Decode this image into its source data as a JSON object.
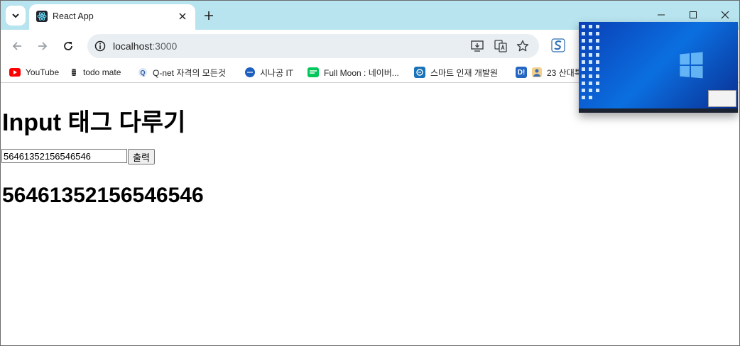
{
  "browser": {
    "tab": {
      "title": "React App"
    },
    "address": {
      "host": "localhost",
      "port": ":3000"
    },
    "bookmarks": [
      {
        "label": "YouTube",
        "icon": "youtube-icon",
        "color": "#ff0000"
      },
      {
        "label": "todo mate",
        "icon": "todo-mate-icon",
        "color": "#222222"
      },
      {
        "label": "Q-net 자격의 모든것",
        "icon": "qnet-icon",
        "color": "#2a5aa8"
      },
      {
        "label": "시나공 IT",
        "icon": "sinagong-icon",
        "color": "#1f5fbf"
      },
      {
        "label": "Full Moon : 네이버...",
        "icon": "naver-blog-icon",
        "color": "#03c75a"
      },
      {
        "label": "스마트 인재 개발원",
        "icon": "smart-icon",
        "color": "#1a73b8"
      },
      {
        "label": "23 산대특",
        "icon": "profile-icon",
        "color": "#2566c2"
      }
    ],
    "bookmark_d_icon": "D!"
  },
  "page": {
    "heading": "Input 태그 다루기",
    "input_value": "56461352156546546",
    "button_label": "출력",
    "output": "56461352156546546"
  },
  "colors": {
    "tabstrip": "#b8e4ef",
    "omnibox": "#e9eef2"
  }
}
